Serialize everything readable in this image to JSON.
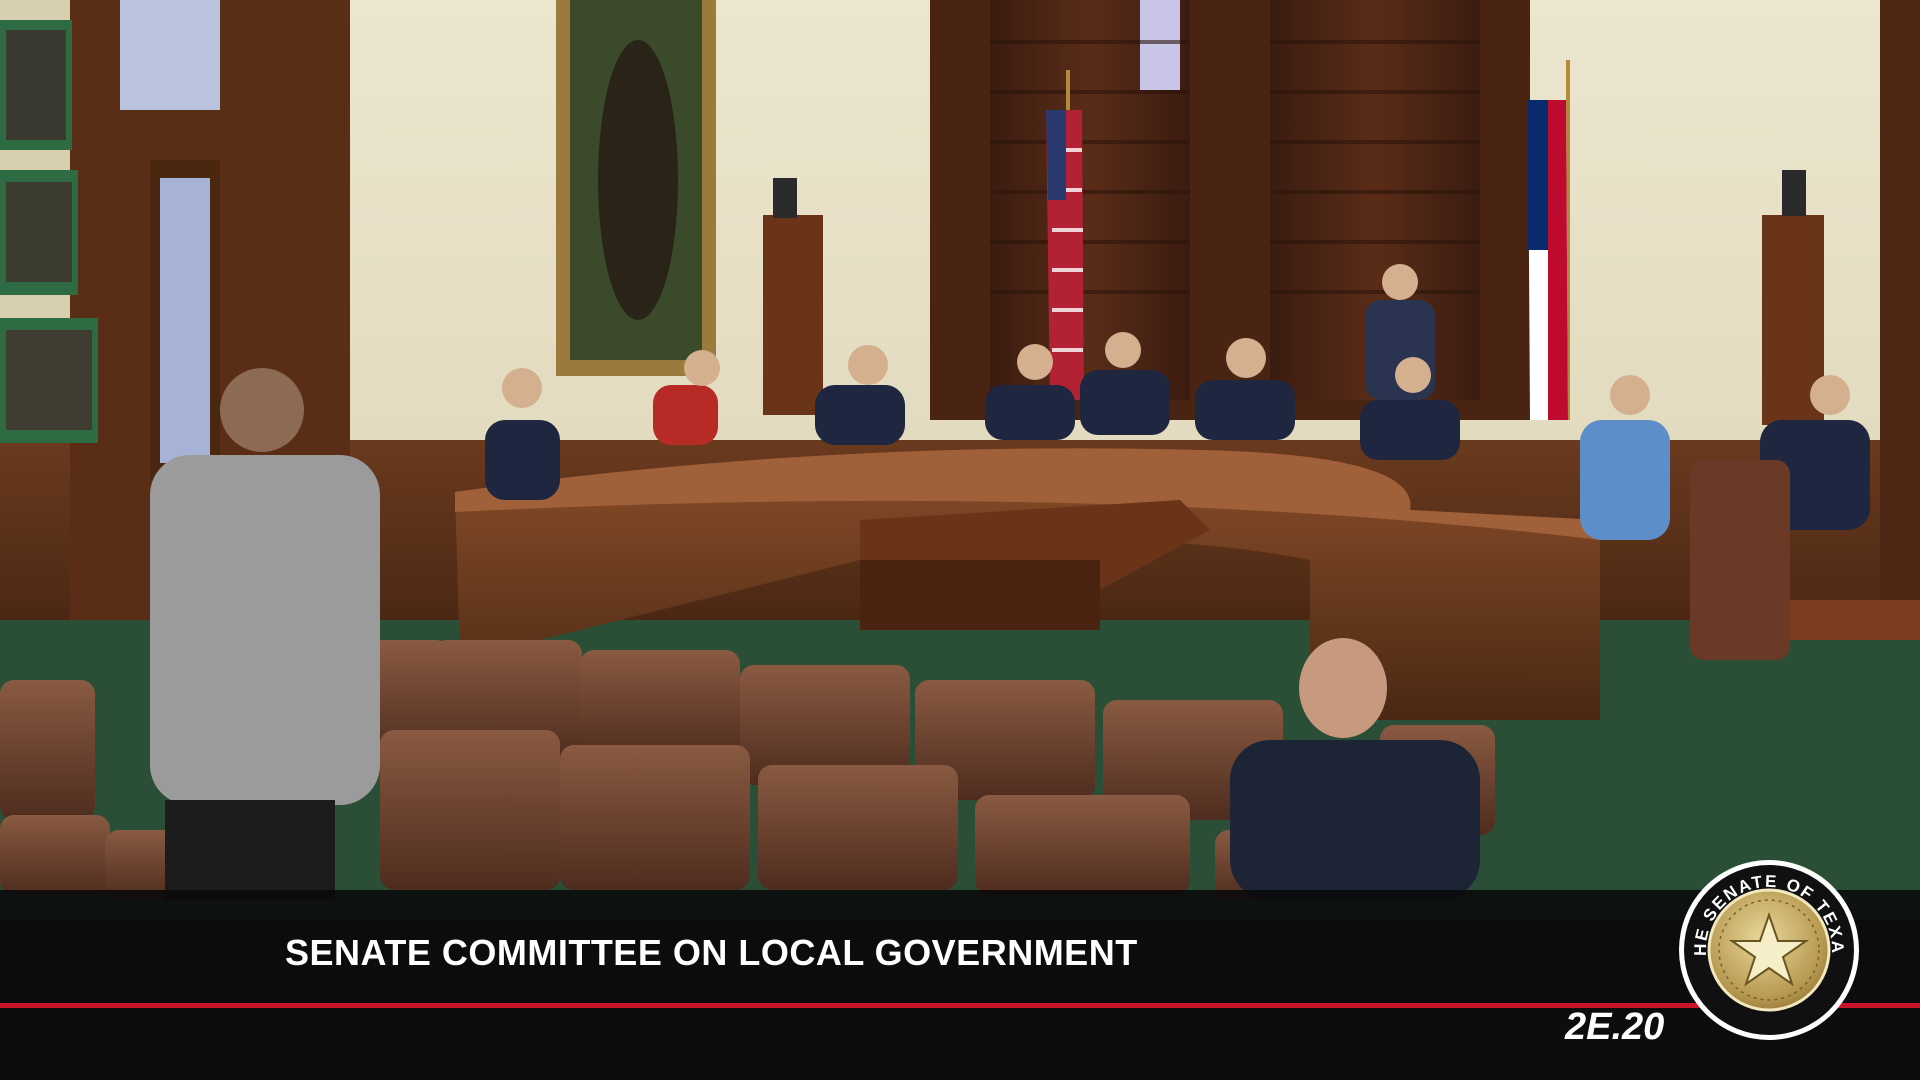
{
  "broadcast": {
    "title": "SENATE COMMITTEE ON LOCAL GOVERNMENT",
    "bill_code": "2E.20",
    "accent_color": "#c8142a"
  },
  "seal": {
    "text": "THE SENATE OF TEXAS",
    "icon": "star-seal-icon"
  }
}
